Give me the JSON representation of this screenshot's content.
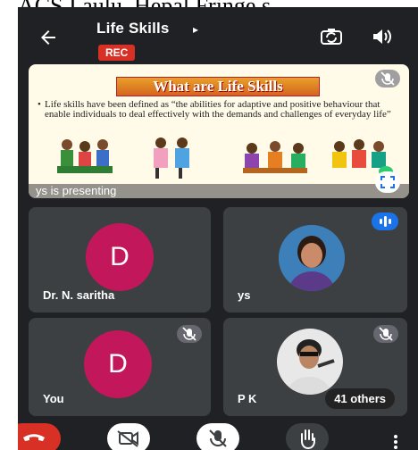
{
  "banner": {
    "text": "ACS I aulu, Hepal Fringe s"
  },
  "header": {
    "back_icon": "arrow-back-icon",
    "title": "Life Skills",
    "title_caret": "▸",
    "rec_label": "REC",
    "switch_camera_icon": "switch-camera-icon",
    "audio_output_icon": "speaker-icon"
  },
  "presentation": {
    "slide_title": "What are Life Skills",
    "slide_text": "Life skills have been defined as “the abilities for adaptive and positive behaviour that enable individuals to deal effectively with the demands and challenges of everyday life”",
    "presenter_label": "ys is presenting",
    "mute_icon": "mic-off-icon",
    "fullscreen_icon": "fullscreen-icon"
  },
  "participants": [
    {
      "name": "Dr. N. saritha",
      "initial": "D",
      "avatar_color": "#c2185b",
      "type": "initial"
    },
    {
      "name": "ys",
      "type": "photo",
      "speaking": true
    },
    {
      "name": "You",
      "initial": "D",
      "avatar_color": "#c2185b",
      "type": "initial",
      "muted": true
    },
    {
      "name": "P K",
      "type": "photo",
      "muted": true,
      "others_label": "41 others"
    }
  ],
  "controls": {
    "end_call_icon": "call-end-icon",
    "camera_icon": "video-off-icon",
    "mic_icon": "mic-off-icon",
    "hand_icon": "raise-hand-icon",
    "more_icon": "more-vert-icon"
  },
  "colors": {
    "background": "#202124",
    "tile": "#3c4043",
    "accent_red": "#d93025",
    "avatar_pink": "#c2185b",
    "speaking_blue": "#1a73e8"
  }
}
